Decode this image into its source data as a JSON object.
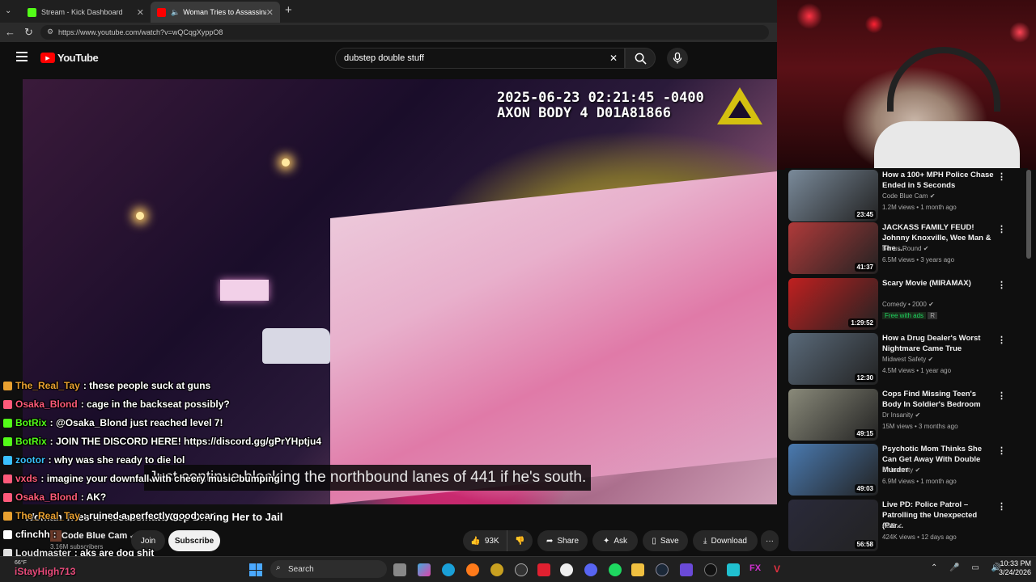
{
  "browser": {
    "tabs": [
      {
        "label": "Stream - Kick Dashboard",
        "icon": "kick-icon",
        "color": "#53fc18"
      },
      {
        "label": "Woman Tries to Assassinate C",
        "icon": "youtube-icon",
        "color": "#ff0000"
      }
    ],
    "new_tab": "+",
    "url": "https://www.youtube.com/watch?v=wQCqgXyppO8"
  },
  "youtube": {
    "logo_text": "YouTube",
    "search_value": "dubstep double stuff",
    "clear_icon": "✕"
  },
  "video": {
    "bodycam_line1": "2025-06-23 02:21:45 -0400",
    "bodycam_line2": "AXON BODY 4 D01A81866",
    "caption": "Just continue blocking the northbound lanes of 441 if he's south.",
    "title": "Woman Tries to Assassinate Cop Driving Her to Jail",
    "channel": "Code Blue Cam",
    "subscribers": "3.16M subscribers",
    "join_label": "Join",
    "subscribe_label": "Subscribe"
  },
  "actions": [
    {
      "icon": "thumbs-up-icon",
      "label": "93K"
    },
    {
      "icon": "thumbs-down-icon",
      "label": ""
    },
    {
      "icon": "share-icon",
      "label": "Share"
    },
    {
      "icon": "sparkle-icon",
      "label": "Ask"
    },
    {
      "icon": "bookmark-icon",
      "label": "Save"
    },
    {
      "icon": "download-icon",
      "label": "Download"
    },
    {
      "icon": "more-icon",
      "label": "···"
    }
  ],
  "chat": [
    {
      "user": "The_Real_Tay",
      "msg": ": these people suck at guns",
      "color": "#e8a030"
    },
    {
      "user": "Osaka_Blond",
      "msg": ": cage in the backseat possibly?",
      "color": "#ff5a7a"
    },
    {
      "user": "BotRix",
      "msg": ": @Osaka_Blond just reached level 7!",
      "color": "#53fc18"
    },
    {
      "user": "BotRix",
      "msg": ": JOIN THE DISCORD HERE! https://discord.gg/gPrYHptju4",
      "color": "#53fc18"
    },
    {
      "user": "zootor",
      "msg": ": why was she ready to die lol",
      "color": "#3ac0ff"
    },
    {
      "user": "vxds",
      "msg": ": imagine your downfall with cheery music bumping",
      "color": "#ff5a7a"
    },
    {
      "user": "Osaka_Blond",
      "msg": ": AK?",
      "color": "#ff5a7a"
    },
    {
      "user": "The_Real_Tay",
      "msg": ": ruined a perfectly good car",
      "color": "#e8a030"
    },
    {
      "user": "cfinchh",
      "msg": ":",
      "color": "#ffffff"
    },
    {
      "user": "Loudmaster",
      "msg": ": aks are dog shit",
      "color": "#e0e0e0"
    }
  ],
  "recommendations": [
    {
      "title": "How a 100+ MPH Police Chase Ended in 5 Seconds",
      "channel": "Code Blue Cam",
      "meta": "1.2M views • 1 month ago",
      "duration": "23:45",
      "tint": "#7a8a9a"
    },
    {
      "title": "JACKASS FAMILY FEUD! Johnny Knoxville, Wee Man & The ...",
      "channel": "Bonus Round",
      "meta": "6.5M views • 3 years ago",
      "duration": "41:37",
      "tint": "#b03a3a"
    },
    {
      "title": "Scary Movie (MIRAMAX)",
      "channel": "Comedy • 2000",
      "meta": "Free with ads",
      "badge": "R",
      "duration": "1:29:52",
      "tint": "#c02020"
    },
    {
      "title": "How a Drug Dealer's Worst Nightmare Came True",
      "channel": "Midwest Safety",
      "meta": "4.5M views • 1 year ago",
      "duration": "12:30",
      "tint": "#5a6a7a"
    },
    {
      "title": "Cops Find Missing Teen's Body In Soldier's Bedroom",
      "channel": "Dr Insanity",
      "meta": "15M views • 3 months ago",
      "duration": "49:15",
      "tint": "#8a8a7a"
    },
    {
      "title": "Psychotic Mom Thinks She Can Get Away With Double Murder",
      "channel": "Dr Insanity",
      "meta": "6.9M views • 1 month ago",
      "duration": "49:03",
      "tint": "#4a7ab0"
    },
    {
      "title": "Live PD: Police Patrol – Patrolling the Unexpected (Par...",
      "channel": "A&E",
      "meta": "424K views • 12 days ago",
      "duration": "56:58",
      "tint": "#2a2a3a"
    }
  ],
  "taskbar": {
    "search": "Search",
    "time": "10:33 PM",
    "date": "3/24/2026",
    "weather": "66°F",
    "streamer": "iStayHigh713"
  }
}
